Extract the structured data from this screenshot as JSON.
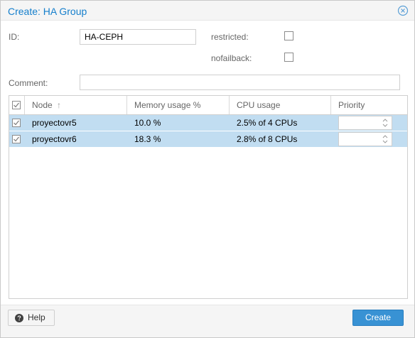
{
  "dialog": {
    "title": "Create: HA Group"
  },
  "form": {
    "id_label": "ID:",
    "id_value": "HA-CEPH",
    "restricted_label": "restricted:",
    "restricted_checked": false,
    "nofailback_label": "nofailback:",
    "nofailback_checked": false,
    "comment_label": "Comment:",
    "comment_value": ""
  },
  "grid": {
    "columns": {
      "node": "Node",
      "sort_indicator": "↑",
      "memory": "Memory usage %",
      "cpu": "CPU usage",
      "priority": "Priority"
    },
    "rows": [
      {
        "selected": true,
        "node": "proyectovr5",
        "memory": "10.0 %",
        "cpu": "2.5% of 4 CPUs",
        "priority": ""
      },
      {
        "selected": true,
        "node": "proyectovr6",
        "memory": "18.3 %",
        "cpu": "2.8% of 8 CPUs",
        "priority": ""
      }
    ]
  },
  "footer": {
    "help_label": "Help",
    "create_label": "Create"
  },
  "colors": {
    "title": "#157fcc",
    "row_selected": "#c1ddf1",
    "primary_button": "#3892d4"
  },
  "icons": {
    "close": "close-circle-icon",
    "help": "question-circle-icon",
    "checkbox_checked": "check-icon",
    "spinner": "spinner-arrows-icon"
  }
}
